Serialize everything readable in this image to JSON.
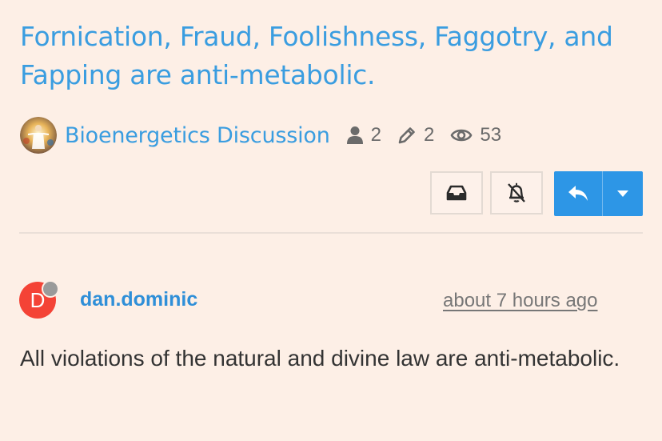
{
  "topic": {
    "title": "Fornication, Fraud, Foolishness, Faggotry, and Fapping are anti-metabolic."
  },
  "meta": {
    "category": "Bioenergetics Discussion",
    "participants": "2",
    "posts": "2",
    "views": "53",
    "icons": [
      "category-avatar",
      "user-icon",
      "pencil-icon",
      "eye-icon"
    ]
  },
  "actions": {
    "icons": [
      "inbox-icon",
      "bell-off-icon",
      "reply-icon",
      "caret-down-icon"
    ],
    "accent": "#2d96e6"
  },
  "post": {
    "avatar_letter": "D",
    "avatar_color": "#f44336",
    "username": "dan.dominic",
    "timestamp": "about 7 hours ago",
    "body": "All violations of the natural and divine law are anti-metabolic."
  }
}
